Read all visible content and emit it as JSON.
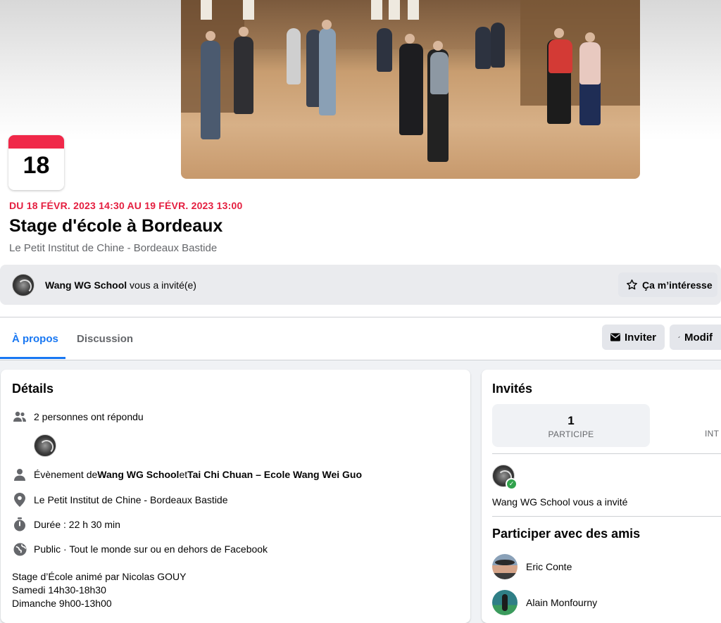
{
  "event": {
    "date_day": "18",
    "date_range": "DU 18 FÉVR. 2023 14:30 AU 19 FÉVR. 2023 13:00",
    "title": "Stage d'école à Bordeaux",
    "location": "Le Petit Institut de Chine - Bordeaux Bastide"
  },
  "invite_bar": {
    "inviter": "Wang WG School",
    "text": " vous a invité(e)",
    "interest_label": "Ça m’intéresse"
  },
  "tabs": [
    {
      "label": "À propos",
      "active": true
    },
    {
      "label": "Discussion",
      "active": false
    }
  ],
  "actions": {
    "invite_label": "Inviter",
    "modify_label": "Modif"
  },
  "details": {
    "heading": "Détails",
    "responded": "2 personnes ont répondu",
    "event_by_prefix": "Évènement de ",
    "organizer1": "Wang WG School",
    "and": " et ",
    "organizer2": "Tai Chi Chuan – Ecole Wang Wei Guo",
    "location": "Le Petit Institut de Chine - Bordeaux Bastide",
    "duration": "Durée : 22 h 30 min",
    "privacy": "Public · Tout le monde sur ou en dehors de Facebook",
    "description": [
      "Stage d’École animé par Nicolas GOUY",
      "Samedi 14h30-18h30",
      "Dimanche 9h00-13h00"
    ]
  },
  "guests": {
    "heading": "Invités",
    "count": "1",
    "count_label": "PARTICIPE",
    "next_label_cut": "INT",
    "invited_text": "Wang WG School vous a invité"
  },
  "friends": {
    "heading": "Participer avec des amis",
    "list": [
      "Eric Conte",
      "Alain Monfourny"
    ]
  },
  "colors": {
    "accent": "#1877f2",
    "date_red": "#e41e3f",
    "calendar_red": "#f02849",
    "going_green": "#31a24c"
  }
}
